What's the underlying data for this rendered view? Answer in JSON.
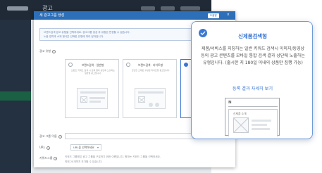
{
  "app": {
    "header_title": "광고",
    "sidebar_items": [
      "",
      "",
      "",
      "",
      "",
      "",
      "",
      "",
      "",
      "",
      "",
      "",
      ""
    ]
  },
  "modal": {
    "title": "새 광고그룹 생성",
    "badge": "도움말",
    "close": "×",
    "info_lines": [
      "브랜드검색 광고 유형을 선택하세요. 광고그룹 생성 후 유형은 변경할 수 없습니다.",
      "노출 영역과 소재 형식은 선택한 유형에 따라 달라집니다."
    ],
    "type_label": "광고 유형",
    "type_cards": [
      {
        "name": "브랜드검색 · 일반형",
        "desc": "브랜드 키워드 검색 시 검색 결과 상단에 노출되는 일반형 광고입니다."
      },
      {
        "name": "브랜드검색 · 라이트형",
        "desc": "간단한 소재로 구성된 라이트형 광고입니다."
      },
      {
        "name": "",
        "desc": ""
      }
    ],
    "group_name_label": "광고 그룹 이름",
    "url_label": "URL",
    "url_select": "URL을 선택하세요",
    "keyword_label": "키워드그룹",
    "keyword_text_lines": [
      "키워드 그룹명은 광고 그룹을 구분하기 위한 이름입니다. 원하는 키워드 그룹을 선택하세요.",
      "최대 20개까지 추가할 수 있습니다."
    ],
    "help_glyph": "?"
  },
  "popup": {
    "title": "신제품검색형",
    "description": "제품/서비스를 지칭하는 일반 키워드 검색시 이미지/동영상 등의 광고 콘텐츠를 모바일 통합 검색 결과 상단에 노출하는 유형입니다. (출시한 지 180일 이내의 상품만 집행 가능)",
    "link": "등록 결과 자세히 보기",
    "preview": {
      "logo": "N",
      "card_label": "신제품 소개"
    },
    "accent_color": "#2f6fd0"
  }
}
